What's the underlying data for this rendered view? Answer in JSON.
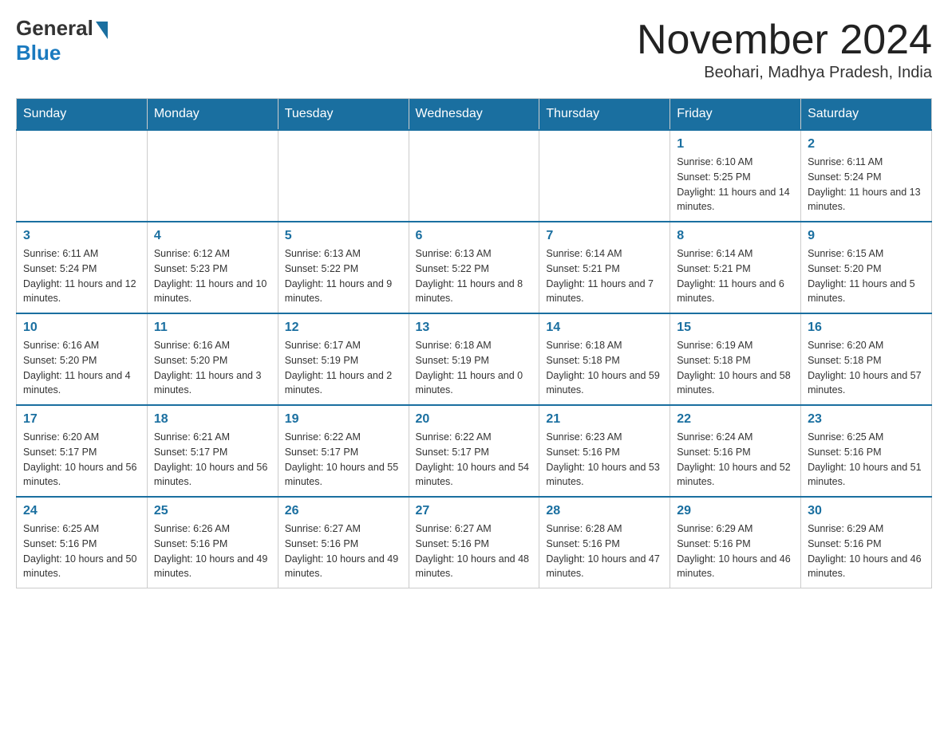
{
  "header": {
    "logo": {
      "general": "General",
      "blue": "Blue"
    },
    "title": "November 2024",
    "location": "Beohari, Madhya Pradesh, India"
  },
  "weekdays": [
    "Sunday",
    "Monday",
    "Tuesday",
    "Wednesday",
    "Thursday",
    "Friday",
    "Saturday"
  ],
  "weeks": [
    [
      {
        "day": "",
        "info": ""
      },
      {
        "day": "",
        "info": ""
      },
      {
        "day": "",
        "info": ""
      },
      {
        "day": "",
        "info": ""
      },
      {
        "day": "",
        "info": ""
      },
      {
        "day": "1",
        "info": "Sunrise: 6:10 AM\nSunset: 5:25 PM\nDaylight: 11 hours and 14 minutes."
      },
      {
        "day": "2",
        "info": "Sunrise: 6:11 AM\nSunset: 5:24 PM\nDaylight: 11 hours and 13 minutes."
      }
    ],
    [
      {
        "day": "3",
        "info": "Sunrise: 6:11 AM\nSunset: 5:24 PM\nDaylight: 11 hours and 12 minutes."
      },
      {
        "day": "4",
        "info": "Sunrise: 6:12 AM\nSunset: 5:23 PM\nDaylight: 11 hours and 10 minutes."
      },
      {
        "day": "5",
        "info": "Sunrise: 6:13 AM\nSunset: 5:22 PM\nDaylight: 11 hours and 9 minutes."
      },
      {
        "day": "6",
        "info": "Sunrise: 6:13 AM\nSunset: 5:22 PM\nDaylight: 11 hours and 8 minutes."
      },
      {
        "day": "7",
        "info": "Sunrise: 6:14 AM\nSunset: 5:21 PM\nDaylight: 11 hours and 7 minutes."
      },
      {
        "day": "8",
        "info": "Sunrise: 6:14 AM\nSunset: 5:21 PM\nDaylight: 11 hours and 6 minutes."
      },
      {
        "day": "9",
        "info": "Sunrise: 6:15 AM\nSunset: 5:20 PM\nDaylight: 11 hours and 5 minutes."
      }
    ],
    [
      {
        "day": "10",
        "info": "Sunrise: 6:16 AM\nSunset: 5:20 PM\nDaylight: 11 hours and 4 minutes."
      },
      {
        "day": "11",
        "info": "Sunrise: 6:16 AM\nSunset: 5:20 PM\nDaylight: 11 hours and 3 minutes."
      },
      {
        "day": "12",
        "info": "Sunrise: 6:17 AM\nSunset: 5:19 PM\nDaylight: 11 hours and 2 minutes."
      },
      {
        "day": "13",
        "info": "Sunrise: 6:18 AM\nSunset: 5:19 PM\nDaylight: 11 hours and 0 minutes."
      },
      {
        "day": "14",
        "info": "Sunrise: 6:18 AM\nSunset: 5:18 PM\nDaylight: 10 hours and 59 minutes."
      },
      {
        "day": "15",
        "info": "Sunrise: 6:19 AM\nSunset: 5:18 PM\nDaylight: 10 hours and 58 minutes."
      },
      {
        "day": "16",
        "info": "Sunrise: 6:20 AM\nSunset: 5:18 PM\nDaylight: 10 hours and 57 minutes."
      }
    ],
    [
      {
        "day": "17",
        "info": "Sunrise: 6:20 AM\nSunset: 5:17 PM\nDaylight: 10 hours and 56 minutes."
      },
      {
        "day": "18",
        "info": "Sunrise: 6:21 AM\nSunset: 5:17 PM\nDaylight: 10 hours and 56 minutes."
      },
      {
        "day": "19",
        "info": "Sunrise: 6:22 AM\nSunset: 5:17 PM\nDaylight: 10 hours and 55 minutes."
      },
      {
        "day": "20",
        "info": "Sunrise: 6:22 AM\nSunset: 5:17 PM\nDaylight: 10 hours and 54 minutes."
      },
      {
        "day": "21",
        "info": "Sunrise: 6:23 AM\nSunset: 5:16 PM\nDaylight: 10 hours and 53 minutes."
      },
      {
        "day": "22",
        "info": "Sunrise: 6:24 AM\nSunset: 5:16 PM\nDaylight: 10 hours and 52 minutes."
      },
      {
        "day": "23",
        "info": "Sunrise: 6:25 AM\nSunset: 5:16 PM\nDaylight: 10 hours and 51 minutes."
      }
    ],
    [
      {
        "day": "24",
        "info": "Sunrise: 6:25 AM\nSunset: 5:16 PM\nDaylight: 10 hours and 50 minutes."
      },
      {
        "day": "25",
        "info": "Sunrise: 6:26 AM\nSunset: 5:16 PM\nDaylight: 10 hours and 49 minutes."
      },
      {
        "day": "26",
        "info": "Sunrise: 6:27 AM\nSunset: 5:16 PM\nDaylight: 10 hours and 49 minutes."
      },
      {
        "day": "27",
        "info": "Sunrise: 6:27 AM\nSunset: 5:16 PM\nDaylight: 10 hours and 48 minutes."
      },
      {
        "day": "28",
        "info": "Sunrise: 6:28 AM\nSunset: 5:16 PM\nDaylight: 10 hours and 47 minutes."
      },
      {
        "day": "29",
        "info": "Sunrise: 6:29 AM\nSunset: 5:16 PM\nDaylight: 10 hours and 46 minutes."
      },
      {
        "day": "30",
        "info": "Sunrise: 6:29 AM\nSunset: 5:16 PM\nDaylight: 10 hours and 46 minutes."
      }
    ]
  ]
}
